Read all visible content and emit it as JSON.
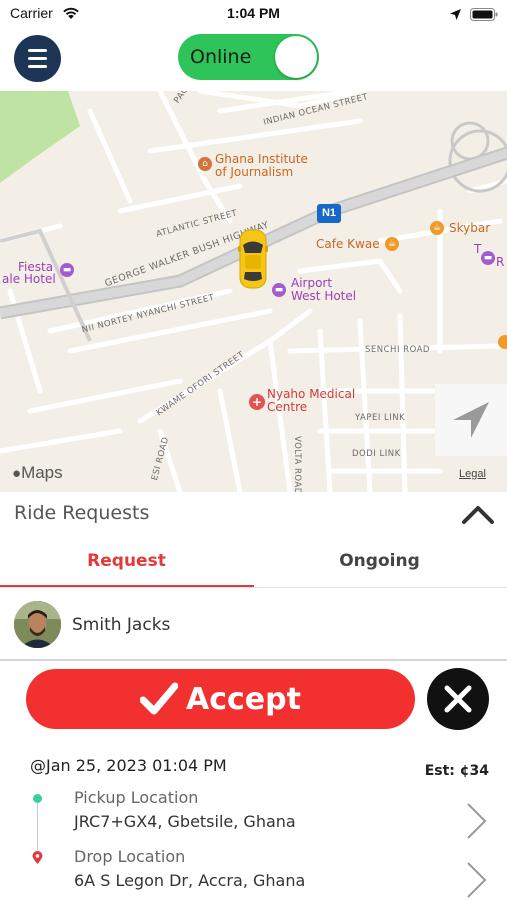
{
  "status_bar": {
    "carrier": "Carrier",
    "time": "1:04 PM"
  },
  "header": {
    "menu_icon": "hamburger-icon",
    "online_label": "Online",
    "online_enabled": true,
    "toggle_color": "#2fc45a"
  },
  "map": {
    "streets": {
      "pacific": "PACI",
      "indian_ocean": "INDIAN OCEAN STREET",
      "atlantic": "ATLANTIC STREET",
      "george_walker": "GEORGE WALKER BUSH HIGHWAY",
      "nortey": "NII NORTEY NYANCHI STREET",
      "kwame_ofori": "KWAME OFORI STREET",
      "senchi": "SENCHI ROAD",
      "yapei": "YAPEI LINK",
      "dodi": "DODI LINK",
      "volta": "VOLTA ROAD",
      "esi": "ESI ROAD"
    },
    "pois": {
      "ghana_institute_line1": "Ghana Institute",
      "ghana_institute_line2": "of Journalism",
      "skybar": "Skybar",
      "cafe_kwae": "Cafe Kwae",
      "fiesta_line1": "Fiesta",
      "fiesta_line2": "ale Hotel",
      "airport_line1": "Airport",
      "airport_line2": "West Hotel",
      "nyaho_line1": "Nyaho Medical",
      "nyaho_line2": "Centre",
      "edge_t": "T",
      "edge_r": "R"
    },
    "highway_badge": "N1",
    "maps_logo": "Maps",
    "legal": "Legal"
  },
  "panel": {
    "title": "Ride Requests",
    "tabs": [
      {
        "label": "Request",
        "active": true
      },
      {
        "label": "Ongoing",
        "active": false
      }
    ]
  },
  "request": {
    "rider_name": "Smith Jacks",
    "accept_label": "Accept",
    "datetime": "@Jan 25, 2023 01:04 PM",
    "estimate": "Est: ¢34",
    "pickup_label": "Pickup Location",
    "pickup_address": "JRC7+GX4, Gbetsile, Ghana",
    "drop_label": "Drop Location",
    "drop_address": "6A S Legon Dr, Accra, Ghana",
    "accent_color": "#f23030"
  }
}
